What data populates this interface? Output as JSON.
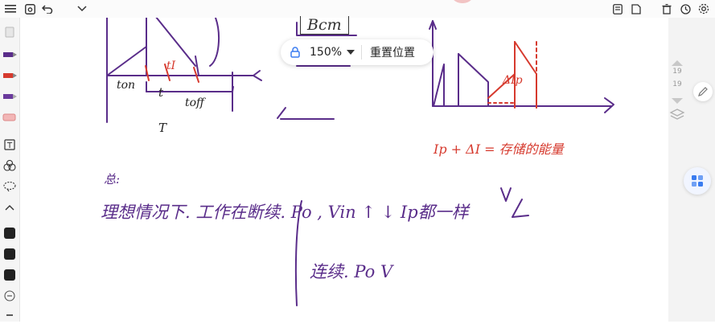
{
  "toolbar": {
    "hamburger_icon": "menu-icon",
    "save_icon": "save-icon",
    "undo_icon": "undo-icon",
    "dropdown_icon": "chevron-down-icon",
    "right_icons": [
      "notebook-icon",
      "page-icon",
      "delete-icon",
      "history-icon",
      "settings-icon"
    ]
  },
  "zoom": {
    "lock_icon": "lock-icon",
    "value": "150%",
    "reset_label": "重置位置"
  },
  "right_panel": {
    "page_numbers": [
      "19",
      "19"
    ]
  },
  "notes": {
    "boxed": "Bcm",
    "label_ton": "ton",
    "label_t": "t",
    "label_toff": "toff",
    "label_T": "T",
    "label_tI": "tI",
    "label_delta_ip": "ΔIp",
    "formula": "Ip + ΔI = 存储的能量",
    "summary_mark": "总:",
    "line1": "理想情况下. 工作在断续.  Po ,  Vin ↑ ↓   Ip都一样",
    "line2": "连续.   Po      V"
  },
  "colors": {
    "ink_purple": "#5a2d8a",
    "ink_red": "#d63a2e",
    "ink_dark": "#222222",
    "accent_blue": "#3a7cf0"
  }
}
